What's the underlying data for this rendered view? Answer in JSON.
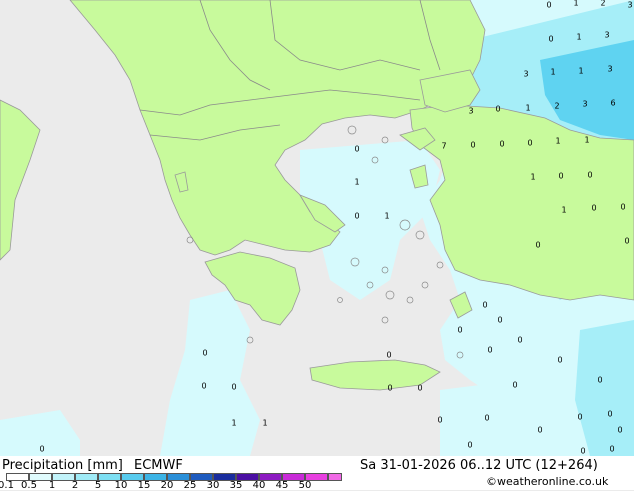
{
  "footer": {
    "title": "Precipitation [mm]",
    "model": "ECMWF",
    "datetime": "Sa 31-01-2026 06..12 UTC (12+264)",
    "credit": "©weatheronline.co.uk"
  },
  "legend": {
    "ticks": [
      "0.1",
      "0.5",
      "1",
      "2",
      "5",
      "10",
      "15",
      "20",
      "25",
      "30",
      "35",
      "40",
      "45",
      "50"
    ],
    "colors": [
      "#ffffff",
      "#e0fbfd",
      "#c2f3fa",
      "#a0ebf7",
      "#7ddff3",
      "#58cbee",
      "#3cb4e6",
      "#2a8fd8",
      "#1e5bbf",
      "#1a2d9e",
      "#4b0fa3",
      "#8d1bc2",
      "#c82bd8",
      "#e83fe0",
      "#f069e6"
    ]
  },
  "colors": {
    "sea": "#ebebeb",
    "land": "#c8fa9c",
    "border": "#9a9a9a",
    "precip_light": "#d6fafd",
    "precip_mid": "#a6eef8",
    "precip_heavy": "#5fd3f1"
  },
  "values": [
    "0",
    "1",
    "2",
    "3",
    "0",
    "1",
    "3",
    "3",
    "1",
    "1",
    "3",
    "3",
    "0",
    "1",
    "2",
    "3",
    "6",
    "7",
    "0",
    "0",
    "0",
    "0",
    "1",
    "1",
    "1",
    "1",
    "0",
    "0",
    "0",
    "1",
    "1",
    "0",
    "0",
    "0",
    "0",
    "0",
    "0",
    "0",
    "0",
    "0",
    "0",
    "0",
    "1",
    "1",
    "0",
    "0",
    "0",
    "0",
    "0",
    "0",
    "0",
    "0",
    "0",
    "0",
    "0",
    "0",
    "0",
    "0",
    "0",
    "0",
    "0"
  ]
}
